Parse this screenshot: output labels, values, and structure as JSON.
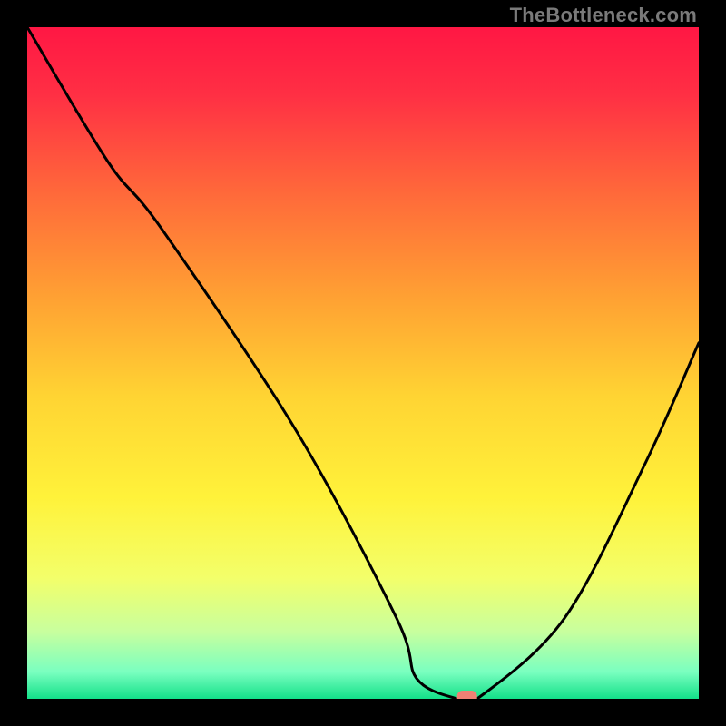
{
  "watermark": "TheBottleneck.com",
  "chart_data": {
    "type": "line",
    "title": "",
    "xlabel": "",
    "ylabel": "",
    "xlim": [
      0,
      100
    ],
    "ylim": [
      0,
      100
    ],
    "grid": false,
    "legend": false,
    "series": [
      {
        "name": "curve",
        "x": [
          0,
          12,
          20,
          40,
          55,
          58,
          64,
          67,
          80,
          92,
          100
        ],
        "y": [
          100,
          80,
          70,
          40,
          12,
          3,
          0,
          0,
          12,
          35,
          53
        ]
      }
    ],
    "marker": {
      "x": 65.5,
      "y": 0,
      "color": "#f08074"
    },
    "background_gradient": {
      "stops": [
        {
          "offset": 0.0,
          "color": "#ff1744"
        },
        {
          "offset": 0.1,
          "color": "#ff2f44"
        },
        {
          "offset": 0.25,
          "color": "#ff6a3a"
        },
        {
          "offset": 0.4,
          "color": "#ffa033"
        },
        {
          "offset": 0.55,
          "color": "#ffd433"
        },
        {
          "offset": 0.7,
          "color": "#fff23a"
        },
        {
          "offset": 0.82,
          "color": "#f3ff6a"
        },
        {
          "offset": 0.9,
          "color": "#c8ff9e"
        },
        {
          "offset": 0.96,
          "color": "#7affc0"
        },
        {
          "offset": 1.0,
          "color": "#13e089"
        }
      ]
    }
  }
}
